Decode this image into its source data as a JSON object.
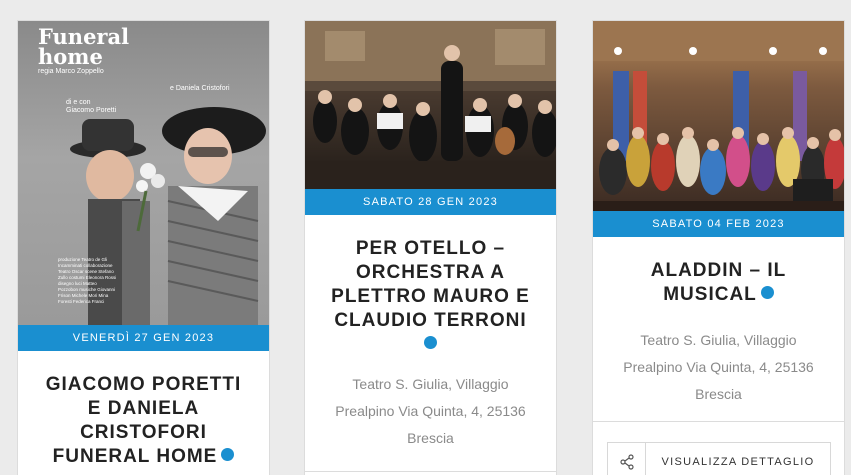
{
  "cards": [
    {
      "date": "VENERDÌ 27 GEN 2023",
      "title_lines": [
        "GIACOMO PORETTI",
        "E DANIELA",
        "CRISTOFORI",
        "FUNERAL HOME"
      ],
      "poster": {
        "title_line1": "Funeral",
        "title_line2": "home",
        "director": "regia Marco Zoppello",
        "with": "e Daniela Cristofori",
        "by_and_with": "di e con",
        "actor": "Giacomo Poretti",
        "credits": "produzione Teatro de Gli Incamminati  collaborazione Teatro Oscar  scene Stefano Zullo  costumi Eleonora Rossi  disegno luci Matteo Pozzobon  musiche Giovanni Frison  Michele Mori  Mina Foresti  Federica Franci"
      }
    },
    {
      "date": "SABATO 28 GEN 2023",
      "title_lines": [
        "PER OTELLO –",
        "ORCHESTRA A",
        "PLETTRO MAURO E",
        "CLAUDIO TERRONI"
      ],
      "address_lines": [
        "Teatro S. Giulia, Villaggio",
        "Prealpino Via Quinta, 4, 25136",
        "Brescia"
      ]
    },
    {
      "date": "SABATO 04 FEB 2023",
      "title_lines": [
        "ALADDIN – IL",
        "MUSICAL"
      ],
      "address_lines": [
        "Teatro S. Giulia, Villaggio",
        "Prealpino Via Quinta, 4, 25136",
        "Brescia"
      ],
      "detail_button": "VISUALIZZA DETTAGLIO"
    }
  ],
  "icons": {
    "share": "share-icon",
    "status_dot": "status-dot"
  },
  "colors": {
    "accent": "#1a8fd0",
    "title": "#222222",
    "address": "#8a8a8a"
  }
}
